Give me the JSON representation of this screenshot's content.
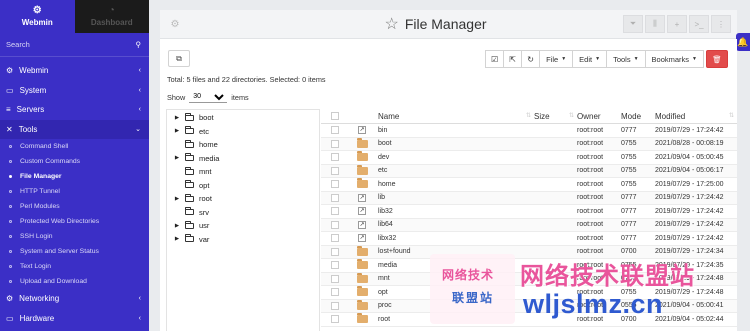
{
  "sidebar": {
    "tabs": [
      {
        "label": "Webmin",
        "icon": "cog-icon"
      },
      {
        "label": "Dashboard",
        "icon": "dashboard-icon"
      }
    ],
    "search_placeholder": "Search",
    "menu": [
      {
        "label": "Webmin",
        "icon": "⚙"
      },
      {
        "label": "System",
        "icon": "▭"
      },
      {
        "label": "Servers",
        "icon": "≡"
      },
      {
        "label": "Tools",
        "icon": "✕"
      }
    ],
    "tools_items": [
      "Command Shell",
      "Custom Commands",
      "File Manager",
      "HTTP Tunnel",
      "Perl Modules",
      "Protected Web Directories",
      "SSH Login",
      "System and Server Status",
      "Text Login",
      "Upload and Download"
    ],
    "active_tool": "File Manager",
    "bottom_menu": [
      {
        "label": "Networking",
        "icon": "⚙"
      },
      {
        "label": "Hardware",
        "icon": "▭"
      }
    ]
  },
  "header": {
    "title": "File Manager"
  },
  "toolbar": {
    "file_label": "File",
    "edit_label": "Edit",
    "tools_label": "Tools",
    "bookmarks_label": "Bookmarks"
  },
  "summary": "Total: 5 files and 22 directories. Selected: 0 items",
  "show": {
    "label": "Show",
    "value": "30",
    "suffix": "items"
  },
  "tree": [
    {
      "name": "boot",
      "expandable": true
    },
    {
      "name": "etc",
      "expandable": true
    },
    {
      "name": "home",
      "expandable": false
    },
    {
      "name": "media",
      "expandable": true
    },
    {
      "name": "mnt",
      "expandable": false
    },
    {
      "name": "opt",
      "expandable": false
    },
    {
      "name": "root",
      "expandable": true
    },
    {
      "name": "srv",
      "expandable": false
    },
    {
      "name": "usr",
      "expandable": true
    },
    {
      "name": "var",
      "expandable": true
    }
  ],
  "columns": {
    "name": "Name",
    "size": "Size",
    "owner": "Owner",
    "mode": "Mode",
    "modified": "Modified"
  },
  "files": [
    {
      "type": "link",
      "name": "bin",
      "size": "",
      "owner": "root:root",
      "mode": "0777",
      "modified": "2019/07/29 - 17:24:42"
    },
    {
      "type": "folder",
      "name": "boot",
      "size": "",
      "owner": "root:root",
      "mode": "0755",
      "modified": "2021/08/28 - 00:08:19"
    },
    {
      "type": "folder",
      "name": "dev",
      "size": "",
      "owner": "root:root",
      "mode": "0755",
      "modified": "2021/09/04 - 05:00:45"
    },
    {
      "type": "folder",
      "name": "etc",
      "size": "",
      "owner": "root:root",
      "mode": "0755",
      "modified": "2021/09/04 - 05:06:17"
    },
    {
      "type": "folder",
      "name": "home",
      "size": "",
      "owner": "root:root",
      "mode": "0755",
      "modified": "2019/07/29 - 17:25:00"
    },
    {
      "type": "link",
      "name": "lib",
      "size": "",
      "owner": "root:root",
      "mode": "0777",
      "modified": "2019/07/29 - 17:24:42"
    },
    {
      "type": "link",
      "name": "lib32",
      "size": "",
      "owner": "root:root",
      "mode": "0777",
      "modified": "2019/07/29 - 17:24:42"
    },
    {
      "type": "link",
      "name": "lib64",
      "size": "",
      "owner": "root:root",
      "mode": "0777",
      "modified": "2019/07/29 - 17:24:42"
    },
    {
      "type": "link",
      "name": "libx32",
      "size": "",
      "owner": "root:root",
      "mode": "0777",
      "modified": "2019/07/29 - 17:24:42"
    },
    {
      "type": "folder",
      "name": "lost+found",
      "size": "",
      "owner": "root:root",
      "mode": "0700",
      "modified": "2019/07/29 - 17:24:34"
    },
    {
      "type": "folder",
      "name": "media",
      "size": "",
      "owner": "root:root",
      "mode": "0755",
      "modified": "2019/07/29 - 17:24:35"
    },
    {
      "type": "folder",
      "name": "mnt",
      "size": "",
      "owner": "root:root",
      "mode": "0755",
      "modified": "2019/07/29 - 17:24:48"
    },
    {
      "type": "folder",
      "name": "opt",
      "size": "",
      "owner": "root:root",
      "mode": "0755",
      "modified": "2019/07/29 - 17:24:48"
    },
    {
      "type": "folder",
      "name": "proc",
      "size": "",
      "owner": "root:root",
      "mode": "0555",
      "modified": "2021/09/04 - 05:00:41"
    },
    {
      "type": "folder",
      "name": "root",
      "size": "",
      "owner": "root:root",
      "mode": "0700",
      "modified": "2021/09/04 - 05:02:44"
    }
  ],
  "watermark": {
    "small_line1": "网络技术",
    "small_line2": "联盟站",
    "big": "网络技术联盟站",
    "url": "wljslmz.cn"
  }
}
